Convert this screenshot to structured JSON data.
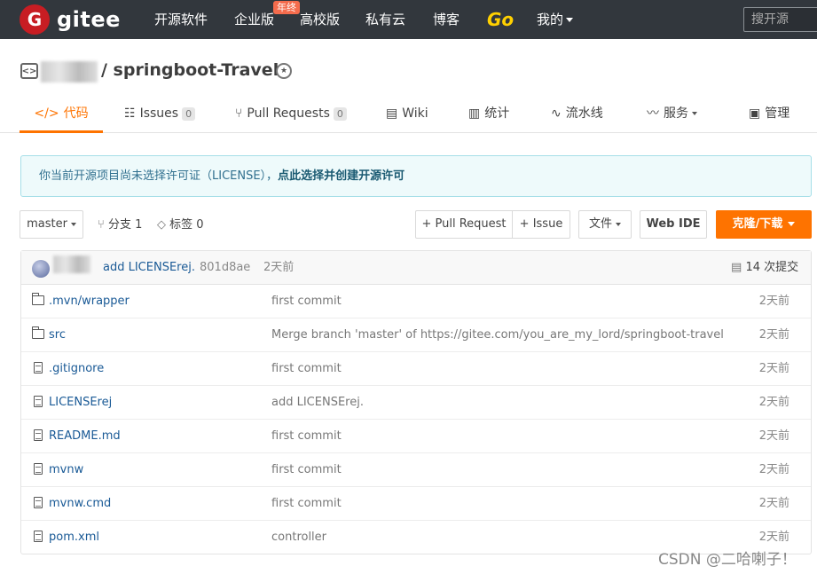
{
  "topnav": {
    "logo_letter": "G",
    "logo_text": "gitee",
    "items": [
      "开源软件",
      "企业版",
      "高校版",
      "私有云",
      "博客",
      "Go",
      "我的"
    ],
    "badge": "年终",
    "search_placeholder": "搜开源"
  },
  "repo": {
    "title": "/ springboot-Travel",
    "icon_name": "code-repo-icon"
  },
  "tabs": [
    {
      "label": "代码",
      "icon": "</>"
    },
    {
      "label": "Issues",
      "count": "0"
    },
    {
      "label": "Pull Requests",
      "count": "0"
    },
    {
      "label": "Wiki"
    },
    {
      "label": "统计"
    },
    {
      "label": "流水线"
    },
    {
      "label": "服务"
    },
    {
      "label": "管理"
    }
  ],
  "notice": {
    "text": "你当前开源项目尚未选择许可证（LICENSE），",
    "link": "点此选择并创建开源许可"
  },
  "toolbar": {
    "branch": "master",
    "branches": "分支 1",
    "tags": "标签 0",
    "pull_request": "+ Pull Request",
    "issue": "+ Issue",
    "file": "文件",
    "web_ide": "Web IDE",
    "clone": "克隆/下载"
  },
  "last_commit": {
    "message": "add LICENSErej.",
    "sha": "801d8ae",
    "time": "2天前",
    "commits": "14 次提交"
  },
  "files": [
    {
      "name": ".mvn/wrapper",
      "type": "folder",
      "message": "first commit",
      "time": "2天前"
    },
    {
      "name": "src",
      "type": "folder",
      "message": "Merge branch 'master' of https://gitee.com/you_are_my_lord/springboot-travel",
      "time": "2天前"
    },
    {
      "name": ".gitignore",
      "type": "file",
      "message": "first commit",
      "time": "2天前"
    },
    {
      "name": "LICENSErej",
      "type": "file",
      "message": "add LICENSErej.",
      "time": "2天前"
    },
    {
      "name": "README.md",
      "type": "file",
      "message": "first commit",
      "time": "2天前"
    },
    {
      "name": "mvnw",
      "type": "file",
      "message": "first commit",
      "time": "2天前"
    },
    {
      "name": "mvnw.cmd",
      "type": "file",
      "message": "first commit",
      "time": "2天前"
    },
    {
      "name": "pom.xml",
      "type": "file",
      "message": "controller",
      "time": "2天前"
    }
  ],
  "watermark": "CSDN @二哈喇子！"
}
